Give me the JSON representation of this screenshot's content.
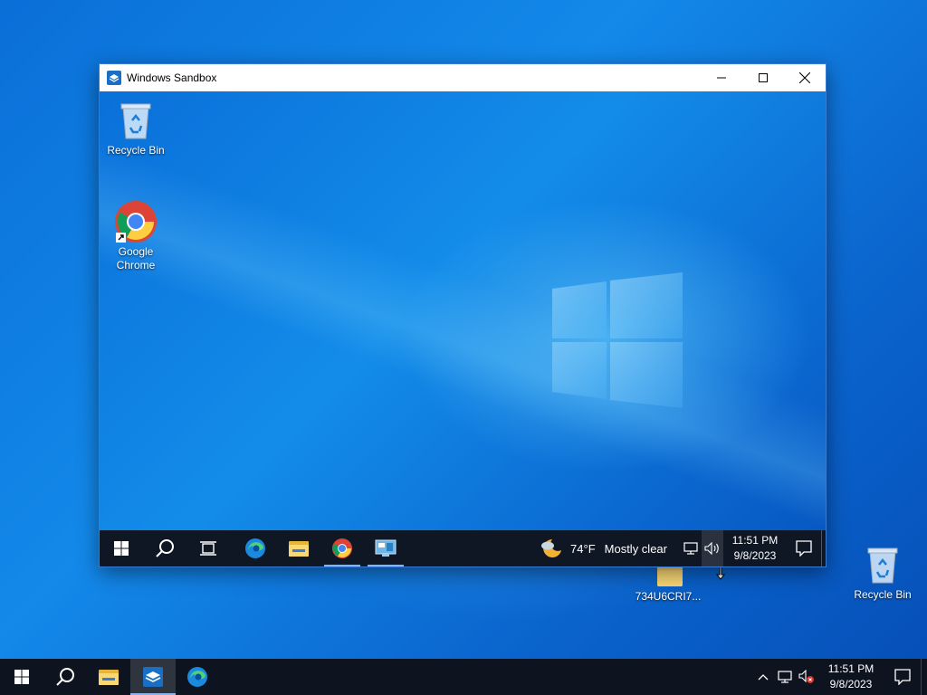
{
  "window": {
    "title": "Windows Sandbox"
  },
  "sandbox_desktop": {
    "icons": [
      {
        "label": "Recycle Bin",
        "icon": "recycle-bin-icon"
      },
      {
        "label": "Google Chrome",
        "icon": "chrome-icon"
      }
    ]
  },
  "sandbox_taskbar": {
    "weather": {
      "temp": "74°F",
      "condition": "Mostly clear",
      "icon": "moon-cloud-icon"
    },
    "clock": {
      "time": "11:51 PM",
      "date": "9/8/2023"
    }
  },
  "host_desktop": {
    "icons": [
      {
        "label": "734U6CRI7...",
        "icon": "folder-icon"
      },
      {
        "label": "Recycle Bin",
        "icon": "recycle-bin-icon"
      }
    ]
  },
  "host_taskbar": {
    "clock": {
      "time": "11:51 PM",
      "date": "9/8/2023"
    }
  },
  "colors": {
    "accent": "#0a70da",
    "taskbar": "#101724",
    "indicator": "#8ab4e8"
  }
}
